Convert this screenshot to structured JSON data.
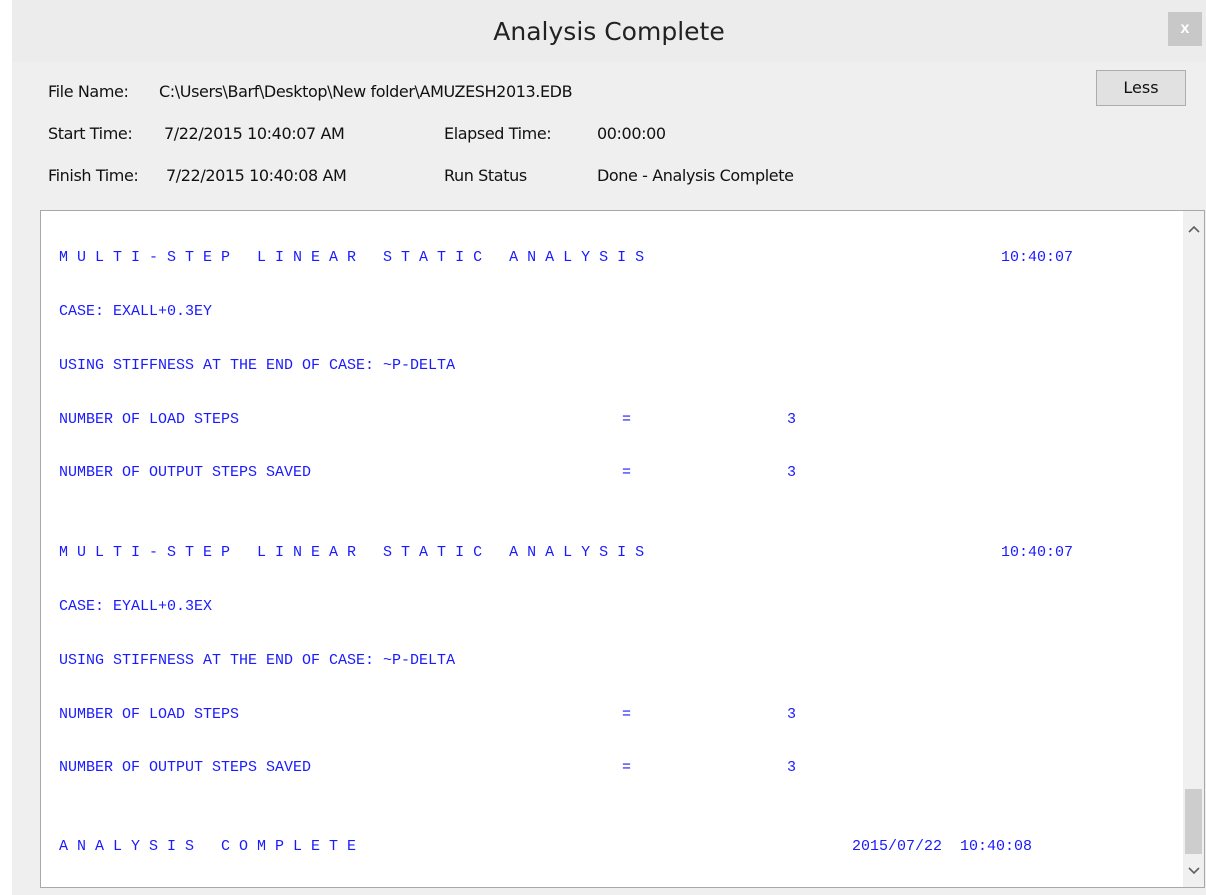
{
  "window": {
    "title": "Analysis Complete",
    "close_label": "x"
  },
  "info": {
    "file_name_label": "File Name:",
    "file_name_value": "C:\\Users\\Barf\\Desktop\\New folder\\AMUZESH2013.EDB",
    "start_time_label": "Start Time:",
    "start_time_value": "7/22/2015 10:40:07 AM",
    "elapsed_time_label": "Elapsed Time:",
    "elapsed_time_value": "00:00:00",
    "finish_time_label": "Finish Time:",
    "finish_time_value": "7/22/2015  10:40:08 AM",
    "run_status_label": "Run Status",
    "run_status_value": "Done - Analysis Complete",
    "less_button": "Less"
  },
  "log": {
    "lines": [
      {
        "text": "M U L T I - S T E P   L I N E A R   S T A T I C   A N A L Y S I S",
        "time": "10:40:07"
      },
      {
        "text": "CASE: EXALL+0.3EY"
      },
      {
        "text": "USING STIFFNESS AT THE END OF CASE: ~P-DELTA"
      },
      {
        "text": "NUMBER OF LOAD STEPS",
        "eq": "=",
        "value": "3"
      },
      {
        "text": "NUMBER OF OUTPUT STEPS SAVED",
        "eq": "=",
        "value": "3"
      },
      {
        "text": "M U L T I - S T E P   L I N E A R   S T A T I C   A N A L Y S I S",
        "time": "10:40:07"
      },
      {
        "text": "CASE: EYALL+0.3EX"
      },
      {
        "text": "USING STIFFNESS AT THE END OF CASE: ~P-DELTA"
      },
      {
        "text": "NUMBER OF LOAD STEPS",
        "eq": "=",
        "value": "3"
      },
      {
        "text": "NUMBER OF OUTPUT STEPS SAVED",
        "eq": "=",
        "value": "3"
      },
      {
        "text": "A N A L Y S I S   C O M P L E T E",
        "time": "2015/07/22  10:40:08"
      }
    ]
  },
  "scroll": {
    "up_icon": "chevron-up-icon",
    "down_icon": "chevron-down-icon"
  },
  "colors": {
    "log_text": "#1a1aff",
    "background": "#efefef"
  }
}
